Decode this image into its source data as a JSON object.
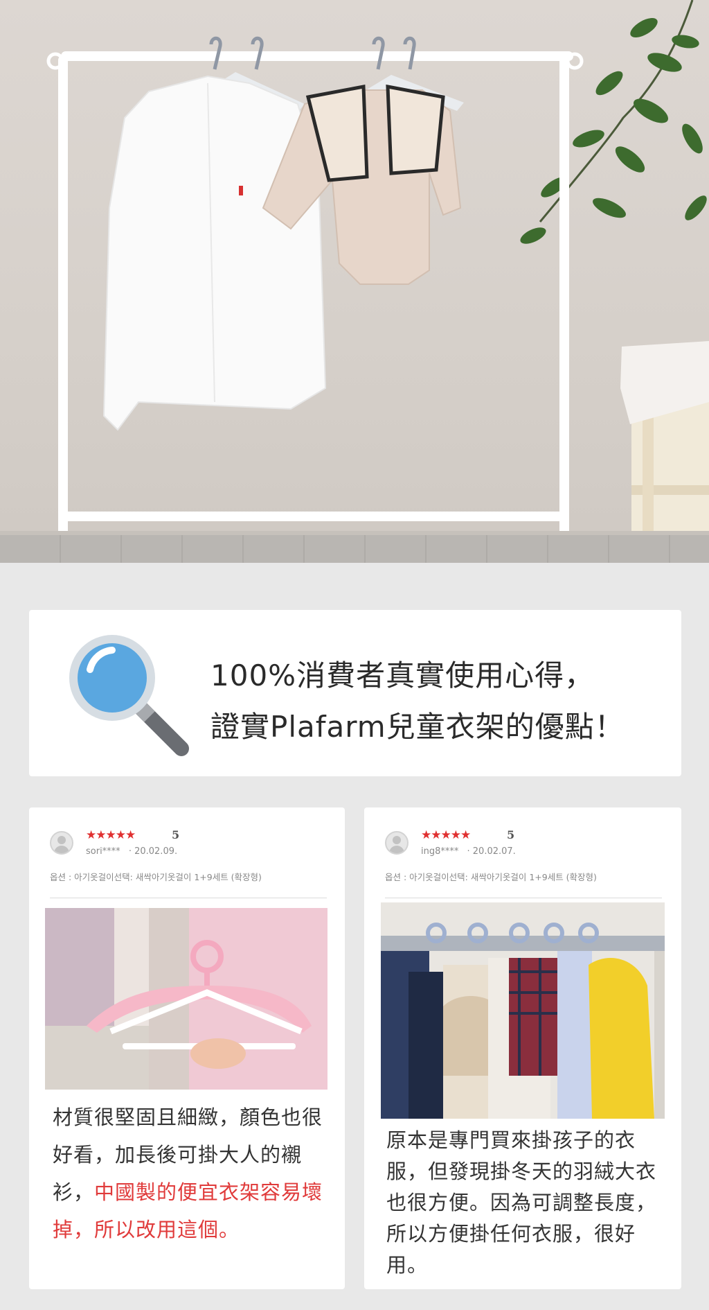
{
  "intro": {
    "line1": "100%消費者真實使用心得，",
    "line2": "證實Plafarm兒童衣架的優點！"
  },
  "reviews": [
    {
      "stars": "★★★★★",
      "score": "5",
      "user": "sori****",
      "date": "· 20.02.09.",
      "option": "옵션 : 아기옷걸이선택: 새싹아기옷걸이 1+9세트 (확장형)",
      "text_before": "材質很堅固且細緻，顏色也很好看，加長後可掛大人的襯衫，",
      "text_highlight": "中國製的便宜衣架容易壞掉，所以改用這個。"
    },
    {
      "stars": "★★★★★",
      "score": "5",
      "user": "ing8****",
      "date": "· 20.02.07.",
      "option": "옵션 : 아기옷걸이선택: 새싹아기옷걸이 1+9세트 (확장형)",
      "text": "原本是專門買來掛孩子的衣服，但發現掛冬天的羽絨大衣也很方便。因為可調整長度，所以方便掛任何衣服，很好用。"
    }
  ],
  "colors": {
    "background": "#e8e8e8",
    "star": "#e03030",
    "highlight": "#e03a3a",
    "magnifier_lens": "#5aa7e0"
  }
}
